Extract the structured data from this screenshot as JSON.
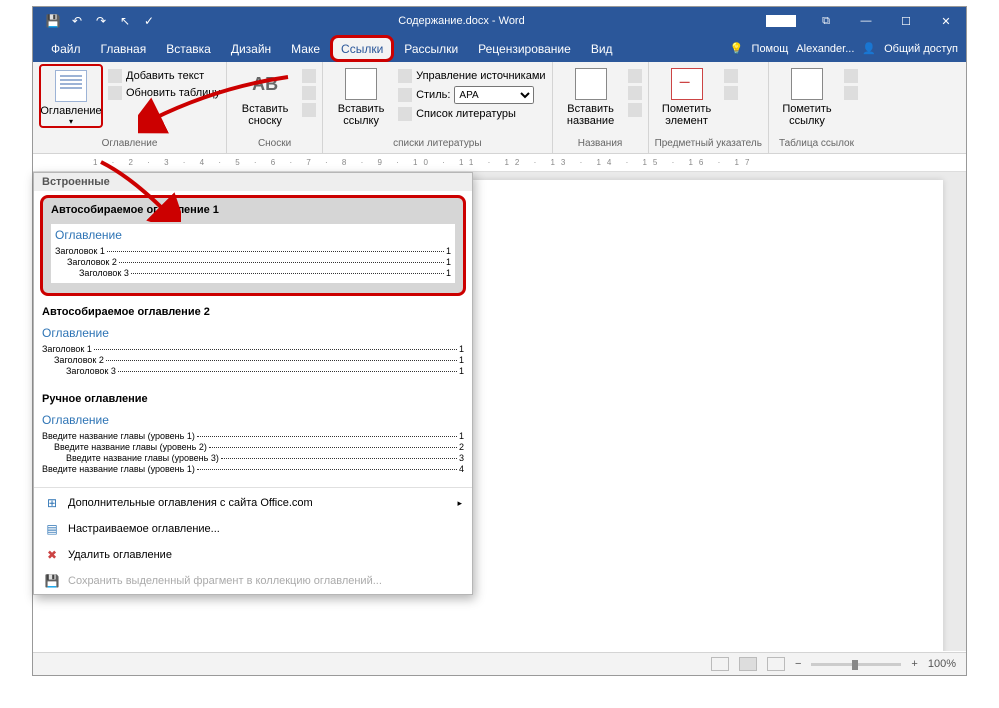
{
  "title": "Содержание.docx - Word",
  "qat": {
    "save": "save",
    "undo": "undo",
    "redo": "redo",
    "ptr": "pointer",
    "spell": "spell"
  },
  "tabs": {
    "file": "Файл",
    "home": "Главная",
    "insert": "Вставка",
    "design": "Дизайн",
    "layout": "Маке",
    "references": "Ссылки",
    "mailings": "Рассылки",
    "review": "Рецензирование",
    "view": "Вид",
    "tell": "Помощ",
    "user": "Alexander...",
    "share": "Общий доступ"
  },
  "ribbon": {
    "toc": {
      "label": "Оглавление"
    },
    "toc_cmds": {
      "add": "Добавить текст",
      "update": "Обновить таблицу"
    },
    "footnote": {
      "btn": "Вставить сноску",
      "ab": "AB"
    },
    "citation": {
      "btn": "Вставить ссылку",
      "manage": "Управление источниками",
      "style_label": "Стиль:",
      "style_value": "APA",
      "biblio": "Список литературы"
    },
    "caption": {
      "btn": "Вставить название"
    },
    "index": {
      "btn": "Пометить элемент"
    },
    "authorities": {
      "btn": "Пометить ссылку"
    },
    "g_fn": "Сноски",
    "g_cit": "списки литературы",
    "g_cap": "Названия",
    "g_idx": "Предметный указатель",
    "g_toa": "Таблица ссылок"
  },
  "dropdown": {
    "header": "Встроенные",
    "auto1": {
      "title": "Автособираемое оглавление 1",
      "heading": "Оглавление",
      "l1": "Заголовок 1",
      "l2": "Заголовок 2",
      "l3": "Заголовок 3",
      "pg": "1"
    },
    "auto2": {
      "title": "Автособираемое оглавление 2",
      "heading": "Оглавление",
      "l1": "Заголовок 1",
      "l2": "Заголовок 2",
      "l3": "Заголовок 3",
      "pg": "1"
    },
    "manual": {
      "title": "Ручное оглавление",
      "heading": "Оглавление",
      "l1a": "Введите название главы (уровень 1)",
      "p1": "1",
      "l2a": "Введите название главы (уровень 2)",
      "p2": "2",
      "l3a": "Введите название главы (уровень 3)",
      "p3": "3",
      "l1b": "Введите название главы (уровень 1)",
      "p4": "4"
    },
    "more": "Дополнительные оглавления с сайта Office.com",
    "custom": "Настраиваемое оглавление...",
    "remove": "Удалить оглавление",
    "save_sel": "Сохранить выделенный фрагмент в коллекцию оглавлений..."
  },
  "ruler": "1 · 2 · 3 · 4 · 5 · 6 · 7 · 8 · 9 · 10 · 11 · 12 · 13 · 14 · 15 · 16 · 17",
  "status": {
    "zoom": "100%"
  },
  "colors": {
    "accent": "#2b579a",
    "highlight": "#c00"
  }
}
